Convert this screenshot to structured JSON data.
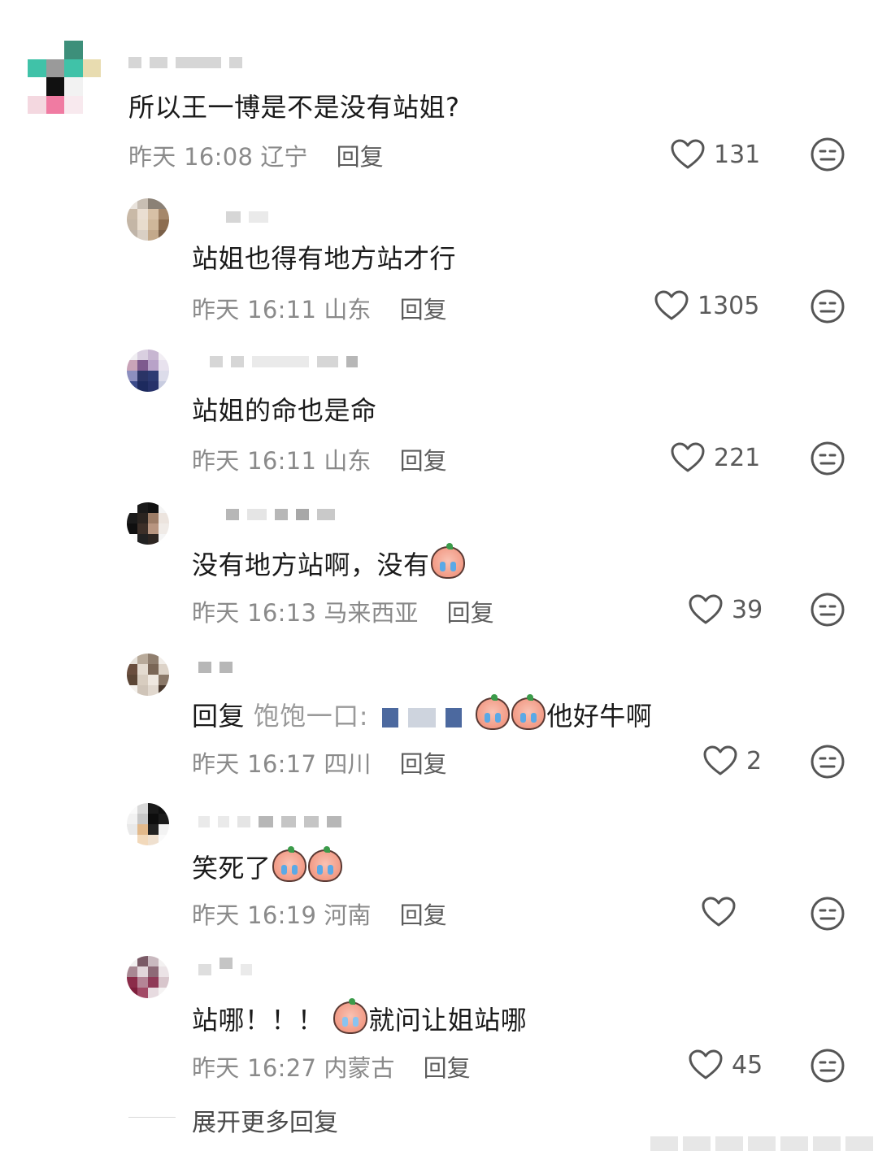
{
  "comments": [
    {
      "text": "所以王一博是不是没有站姐?",
      "time": "昨天 16:08",
      "location": "辽宁",
      "reply": "回复",
      "likes": "131"
    },
    {
      "text": "站姐也得有地方站才行",
      "time": "昨天 16:11",
      "location": "山东",
      "reply": "回复",
      "likes": "1305"
    },
    {
      "text": "站姐的命也是命",
      "time": "昨天 16:11",
      "location": "山东",
      "reply": "回复",
      "likes": "221"
    },
    {
      "text": "没有地方站啊，没有",
      "time": "昨天 16:13",
      "location": "马来西亚",
      "reply": "回复",
      "likes": "39"
    },
    {
      "reply_prefix": "回复",
      "reply_target": "饱饱一口:",
      "text": "他好牛啊",
      "time": "昨天 16:17",
      "location": "四川",
      "reply": "回复",
      "likes": "2"
    },
    {
      "text": "笑死了",
      "time": "昨天 16:19",
      "location": "河南",
      "reply": "回复",
      "likes": ""
    },
    {
      "text_a": "站哪！！！",
      "text_b": "就问让姐站哪",
      "time": "昨天 16:27",
      "location": "内蒙古",
      "reply": "回复",
      "likes": "45"
    }
  ],
  "expand_label": "展开更多回复",
  "icons": {
    "like": "heart-outline-icon",
    "dislike": "meh-face-icon",
    "emoji": "crying-peach-emoji"
  },
  "colors": {
    "text": "#1a1a1a",
    "meta": "#8a8a8a",
    "reply": "#5c5c5c",
    "icon": "#555555"
  }
}
